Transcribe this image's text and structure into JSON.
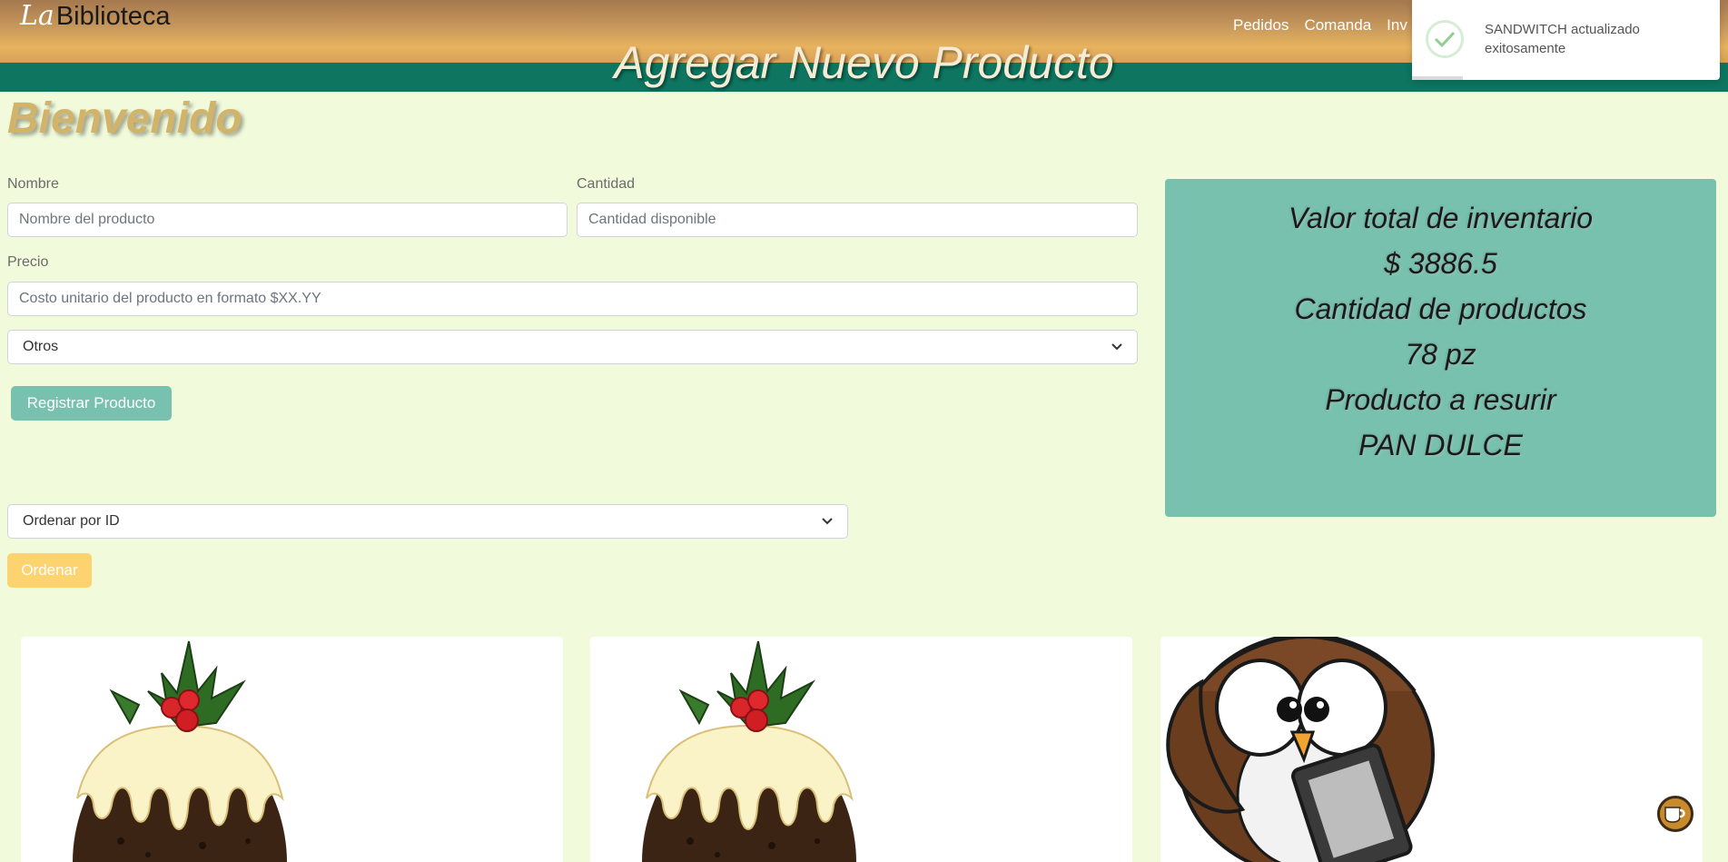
{
  "brand": {
    "script": "La",
    "name": "Biblioteca"
  },
  "nav": {
    "items": [
      "Pedidos",
      "Comanda",
      "Inv"
    ]
  },
  "header": {
    "title": "Agregar Nuevo Producto"
  },
  "welcome": "Bienvenido",
  "form": {
    "name_label": "Nombre",
    "name_placeholder": "Nombre del producto",
    "qty_label": "Cantidad",
    "qty_placeholder": "Cantidad disponible",
    "price_label": "Precio",
    "price_placeholder": "Costo unitario del producto en formato $XX.YY",
    "category_value": "Otros",
    "register_button": "Registrar Producto"
  },
  "sort": {
    "value": "Ordenar por ID",
    "button": "Ordenar"
  },
  "stats": {
    "total_label": "Valor total de inventario",
    "total_value": "$ 3886.5",
    "count_label": "Cantidad de productos",
    "count_value": "78 pz",
    "restock_label": "Producto a resurir",
    "restock_value": "PAN DULCE"
  },
  "toast": {
    "message": "SANDWITCH actualizado exitosamente",
    "icon": "check-icon"
  },
  "cards": [
    {
      "image": "christmas-pudding"
    },
    {
      "image": "christmas-pudding"
    },
    {
      "image": "owl-reading-ereader"
    }
  ],
  "fab": {
    "icon": "coffee-cup-icon"
  },
  "colors": {
    "teal": "#77c1ae",
    "accent": "#fcd36f",
    "background": "#f1fbdc",
    "band": "#0d7560"
  }
}
